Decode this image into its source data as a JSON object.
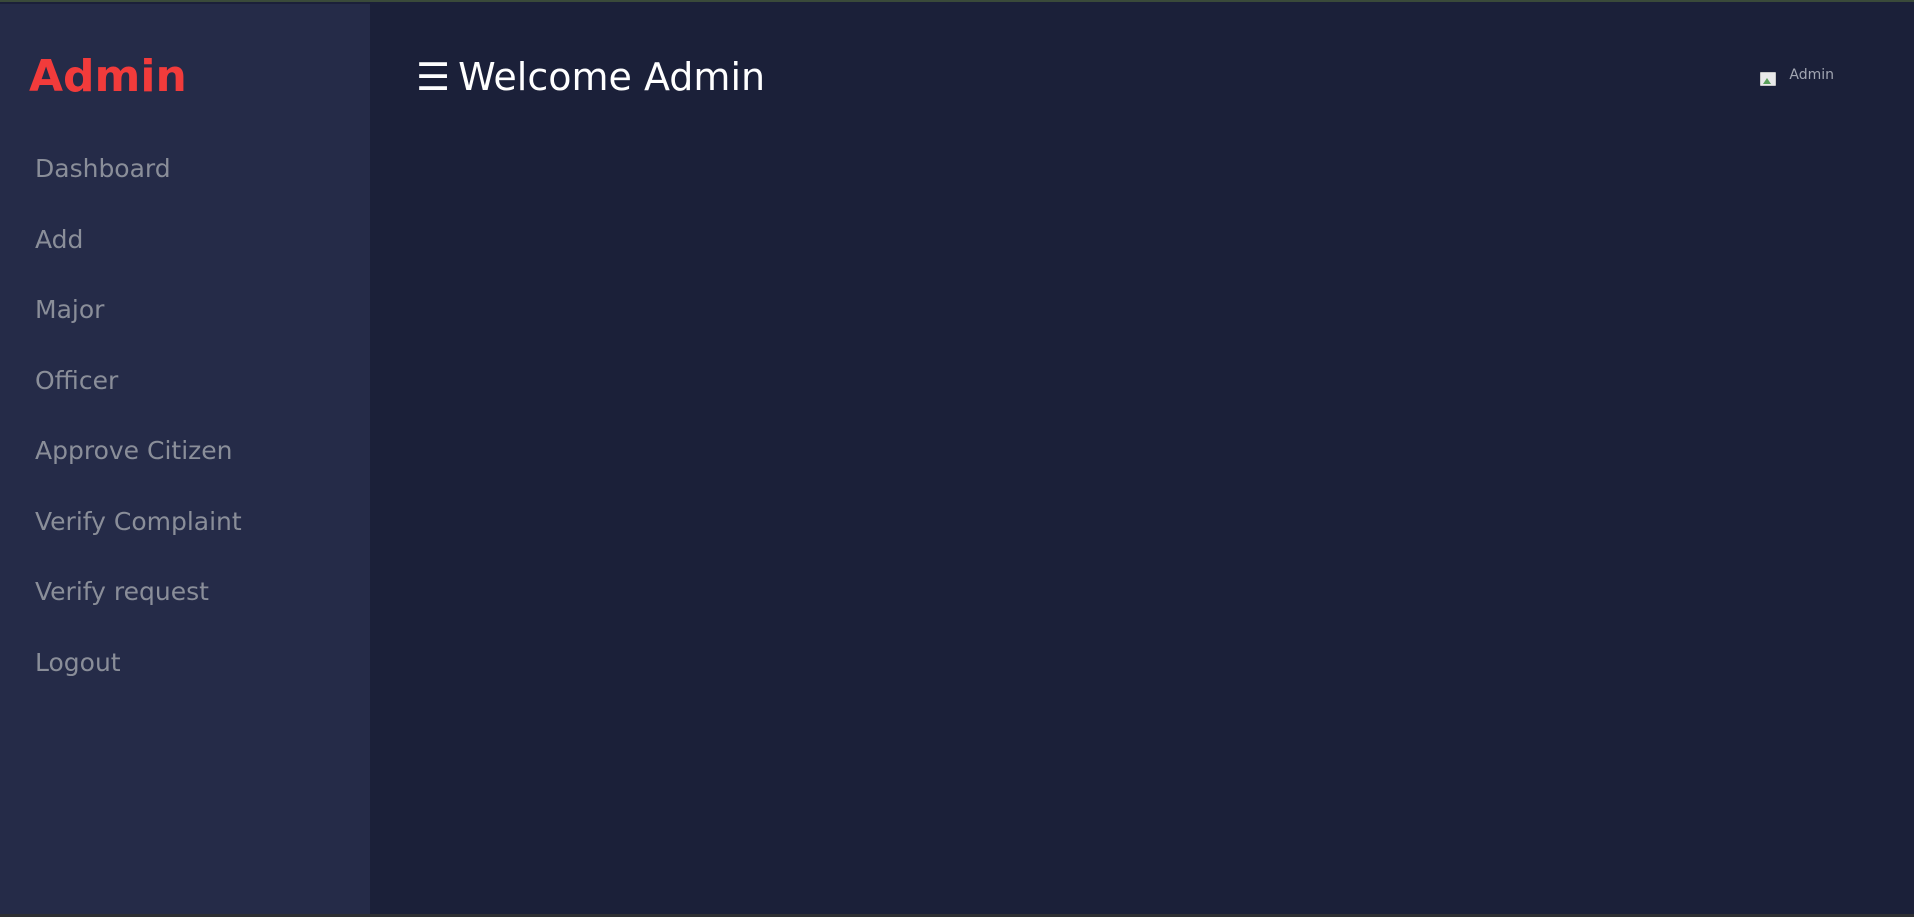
{
  "sidebar": {
    "brand": "Admin",
    "items": [
      {
        "label": "Dashboard"
      },
      {
        "label": "Add"
      },
      {
        "label": "Major"
      },
      {
        "label": "Officer"
      },
      {
        "label": "Approve Citizen"
      },
      {
        "label": "Verify Complaint"
      },
      {
        "label": "Verify request"
      },
      {
        "label": "Logout"
      }
    ]
  },
  "header": {
    "menu_icon": "☰",
    "title": "Welcome Admin",
    "user_label": "Admin"
  },
  "colors": {
    "brand": "#f23b3b",
    "sidebar_bg": "#252b48",
    "main_bg": "#1b2039",
    "nav_text": "#8a8e99",
    "title_text": "#ffffff"
  },
  "icons": {
    "menu": "hamburger-menu-icon",
    "avatar": "broken-image-icon"
  }
}
